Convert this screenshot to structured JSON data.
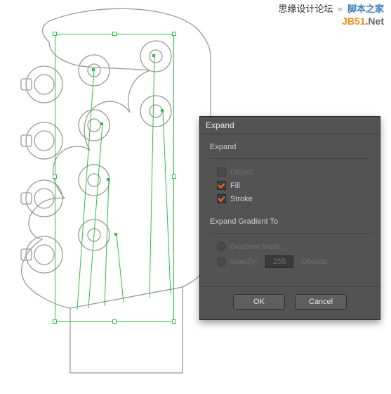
{
  "header": {
    "site1": "思缘设计论坛",
    "sep": "«",
    "site2": "脚本之家",
    "brand1": "JB51",
    "brand2": ".Net"
  },
  "dialog": {
    "title": "Expand",
    "group1_label": "Expand",
    "opt_object": "Object",
    "opt_fill": "Fill",
    "opt_stroke": "Stroke",
    "group2_label": "Expand Gradient To",
    "opt_mesh": "Gradient Mesh",
    "opt_specify_pre": "Specify:",
    "opt_specify_value": "255",
    "opt_specify_post": "Objects",
    "ok": "OK",
    "cancel": "Cancel"
  }
}
